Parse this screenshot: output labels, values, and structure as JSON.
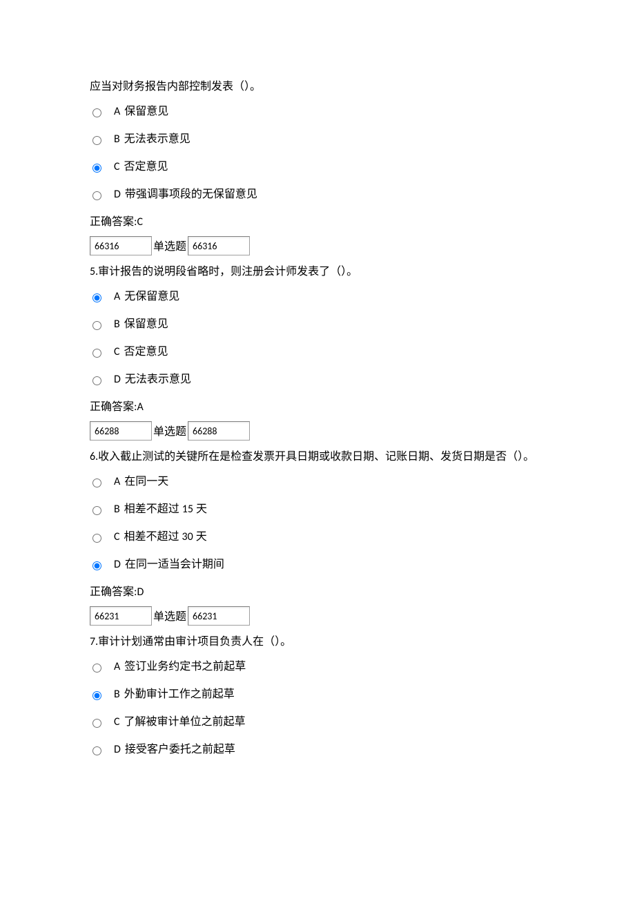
{
  "q4": {
    "partial_text": "应当对财务报告内部控制发表（）。",
    "options": [
      {
        "letter": "A",
        "text": "保留意见",
        "selected": false
      },
      {
        "letter": "B",
        "text": "无法表示意见",
        "selected": false
      },
      {
        "letter": "C",
        "text": "否定意见",
        "selected": true
      },
      {
        "letter": "D",
        "text": "带强调事项段的无保留意见",
        "selected": false
      }
    ],
    "answer_label": "正确答案:",
    "answer": "C",
    "code1": "66316",
    "type_label": "单选题",
    "code2": "66316"
  },
  "q5": {
    "number": "5.",
    "text": "审计报告的说明段省略时，则注册会计师发表了（）。",
    "options": [
      {
        "letter": "A",
        "text": "无保留意见",
        "selected": true
      },
      {
        "letter": "B",
        "text": "保留意见",
        "selected": false
      },
      {
        "letter": "C",
        "text": "否定意见",
        "selected": false
      },
      {
        "letter": "D",
        "text": "无法表示意见",
        "selected": false
      }
    ],
    "answer_label": "正确答案:",
    "answer": "A",
    "code1": "66288",
    "type_label": "单选题",
    "code2": "66288"
  },
  "q6": {
    "number": "6.",
    "text": "收入截止测试的关键所在是检查发票开具日期或收款日期、记账日期、发货日期是否（）。",
    "options": [
      {
        "letter": "A",
        "text": "在同一天",
        "selected": false
      },
      {
        "letter": "B",
        "text_pre": "相差不超过 ",
        "num": "15",
        "text_post": " 天",
        "selected": false
      },
      {
        "letter": "C",
        "text_pre": "相差不超过 ",
        "num": "30",
        "text_post": " 天",
        "selected": false
      },
      {
        "letter": "D",
        "text": "在同一适当会计期间",
        "selected": true
      }
    ],
    "answer_label": "正确答案:",
    "answer": "D",
    "code1": "66231",
    "type_label": "单选题",
    "code2": "66231"
  },
  "q7": {
    "number": "7.",
    "text": "审计计划通常由审计项目负责人在（）。",
    "options": [
      {
        "letter": "A",
        "text": "签订业务约定书之前起草",
        "selected": false
      },
      {
        "letter": "B",
        "text": "外勤审计工作之前起草",
        "selected": true
      },
      {
        "letter": "C",
        "text": "了解被审计单位之前起草",
        "selected": false
      },
      {
        "letter": "D",
        "text": "接受客户委托之前起草",
        "selected": false
      }
    ]
  }
}
